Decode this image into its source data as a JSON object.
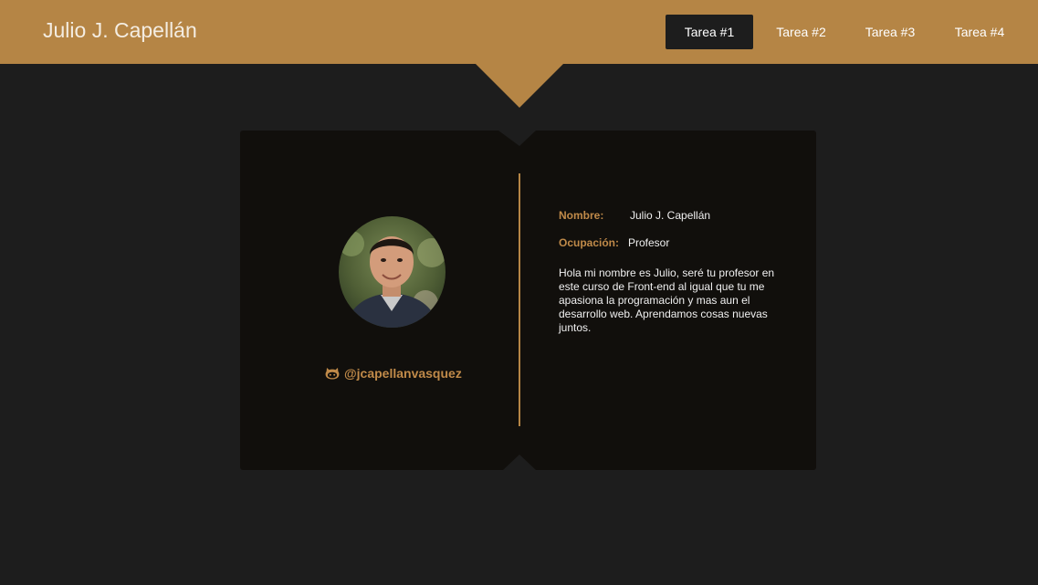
{
  "header": {
    "title": "Julio J. Capellán",
    "nav": [
      {
        "label": "Tarea #1",
        "active": true
      },
      {
        "label": "Tarea #2",
        "active": false
      },
      {
        "label": "Tarea #3",
        "active": false
      },
      {
        "label": "Tarea #4",
        "active": false
      }
    ]
  },
  "profile": {
    "github_handle": "@jcapellanvasquez",
    "github_icon": "github-icon",
    "fields": {
      "name_label": "Nombre:",
      "name_value": "Julio J. Capellán",
      "job_label": "Ocupación:",
      "job_value": "Profesor"
    },
    "bio": "Hola mi nombre es Julio, seré tu profesor en este curso de Front-end al igual que tu me apasiona la programación y mas aun el desarrollo web. Aprendamos cosas nuevas juntos."
  },
  "colors": {
    "accent": "#b58545",
    "background": "#1d1d1d",
    "card": "#110f0c"
  }
}
